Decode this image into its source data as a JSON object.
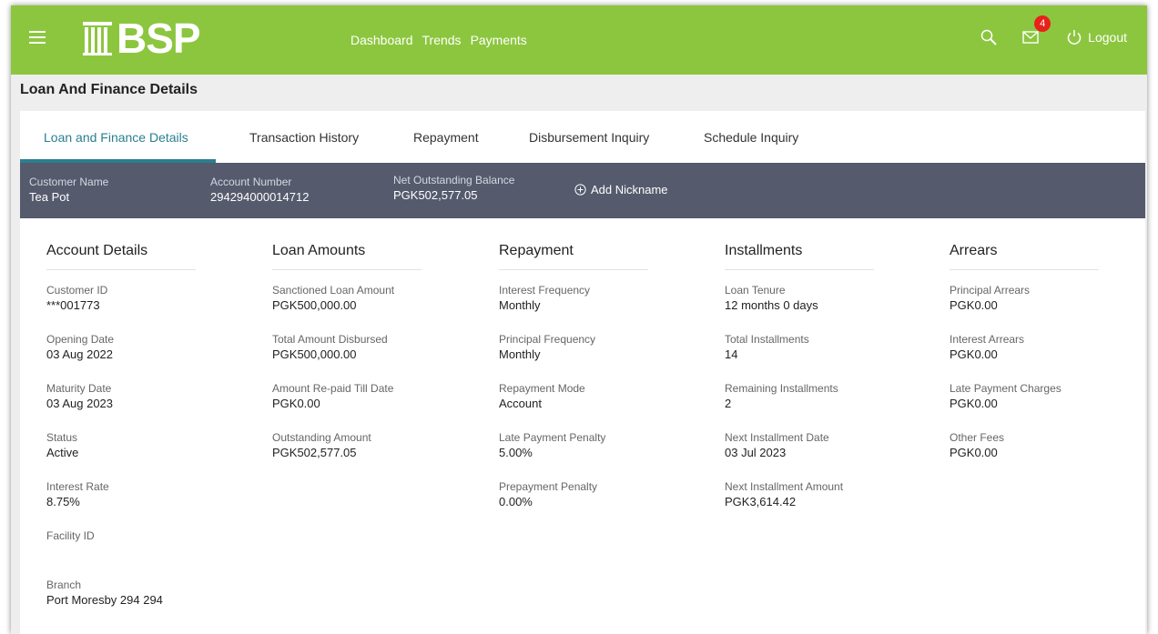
{
  "header": {
    "logo_text": "BSP",
    "nav": [
      "Dashboard",
      "Trends",
      "Payments"
    ],
    "notifications_count": "4",
    "logout_label": "Logout",
    "brand_color": "#8cc63f"
  },
  "page_title": "Loan And Finance Details",
  "tabs": [
    {
      "label": "Loan and Finance Details",
      "active": true
    },
    {
      "label": "Transaction History"
    },
    {
      "label": "Repayment"
    },
    {
      "label": "Disbursement Inquiry"
    },
    {
      "label": "Schedule Inquiry"
    }
  ],
  "summary": {
    "customer_name_label": "Customer Name",
    "customer_name": "Tea Pot",
    "account_number_label": "Account Number",
    "account_number": "294294000014712",
    "net_balance_label": "Net Outstanding Balance",
    "net_balance": "PGK502,577.05",
    "add_nickname": "Add Nickname"
  },
  "sections": [
    {
      "title": "Account Details",
      "fields": [
        {
          "label": "Customer ID",
          "value": "***001773"
        },
        {
          "label": "Opening Date",
          "value": "03 Aug 2022"
        },
        {
          "label": "Maturity Date",
          "value": "03 Aug 2023"
        },
        {
          "label": "Status",
          "value": "Active"
        },
        {
          "label": "Interest Rate",
          "value": "8.75%"
        },
        {
          "label": "Facility ID",
          "value": ""
        },
        {
          "label": "Branch",
          "value": "Port Moresby 294 294"
        }
      ]
    },
    {
      "title": "Loan Amounts",
      "fields": [
        {
          "label": "Sanctioned Loan Amount",
          "value": "PGK500,000.00"
        },
        {
          "label": "Total Amount Disbursed",
          "value": "PGK500,000.00"
        },
        {
          "label": "Amount Re-paid Till Date",
          "value": "PGK0.00"
        },
        {
          "label": "Outstanding Amount",
          "value": "PGK502,577.05"
        }
      ]
    },
    {
      "title": "Repayment",
      "fields": [
        {
          "label": "Interest Frequency",
          "value": "Monthly"
        },
        {
          "label": "Principal Frequency",
          "value": "Monthly"
        },
        {
          "label": "Repayment Mode",
          "value": "Account"
        },
        {
          "label": "Late Payment Penalty",
          "value": "5.00%"
        },
        {
          "label": "Prepayment Penalty",
          "value": "0.00%"
        }
      ]
    },
    {
      "title": "Installments",
      "fields": [
        {
          "label": "Loan Tenure",
          "value": "12 months 0 days"
        },
        {
          "label": "Total Installments",
          "value": "14"
        },
        {
          "label": "Remaining Installments",
          "value": "2"
        },
        {
          "label": "Next Installment Date",
          "value": "03 Jul 2023"
        },
        {
          "label": "Next Installment Amount",
          "value": "PGK3,614.42"
        }
      ]
    },
    {
      "title": "Arrears",
      "fields": [
        {
          "label": "Principal Arrears",
          "value": "PGK0.00"
        },
        {
          "label": "Interest Arrears",
          "value": "PGK0.00"
        },
        {
          "label": "Late Payment Charges",
          "value": "PGK0.00"
        },
        {
          "label": "Other Fees",
          "value": "PGK0.00"
        }
      ]
    }
  ]
}
